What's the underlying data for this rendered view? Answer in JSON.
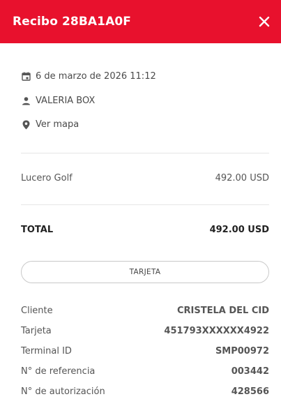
{
  "header": {
    "title": "Recibo 28BA1A0F",
    "accent_color": "#e8112d"
  },
  "meta": {
    "date": "6 de marzo de 2026 11:12",
    "user": "VALERIA BOX",
    "map_link": "Ver mapa"
  },
  "items": [
    {
      "name": "Lucero Golf",
      "amount": "492.00 USD"
    }
  ],
  "total": {
    "label": "TOTAL",
    "amount": "492.00 USD"
  },
  "payment_method": "TARJETA",
  "details": [
    {
      "label": "Cliente",
      "value": "CRISTELA DEL CID"
    },
    {
      "label": "Tarjeta",
      "value": "451793XXXXXX4922"
    },
    {
      "label": "Terminal ID",
      "value": "SMP00972"
    },
    {
      "label": "N° de referencia",
      "value": "003442"
    },
    {
      "label": "N° de autorización",
      "value": "428566"
    }
  ],
  "icons": [
    "close-icon",
    "calendar-icon",
    "person-icon",
    "location-pin-icon"
  ]
}
